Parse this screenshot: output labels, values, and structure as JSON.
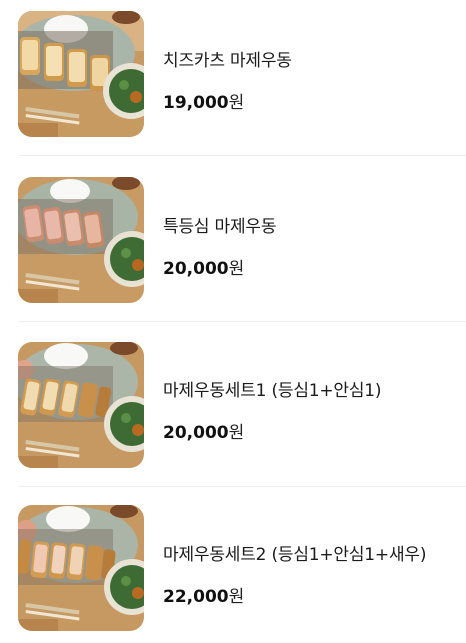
{
  "menu": {
    "items": [
      {
        "name": "치즈카츠 마제우동",
        "price": "19,000",
        "unit": "원"
      },
      {
        "name": "특등심 마제우동",
        "price": "20,000",
        "unit": "원"
      },
      {
        "name": "마제우동세트1 (등심1+안심1)",
        "price": "20,000",
        "unit": "원"
      },
      {
        "name": "마제우동세트2 (등심1+안심1+새우)",
        "price": "22,000",
        "unit": "원"
      }
    ]
  }
}
